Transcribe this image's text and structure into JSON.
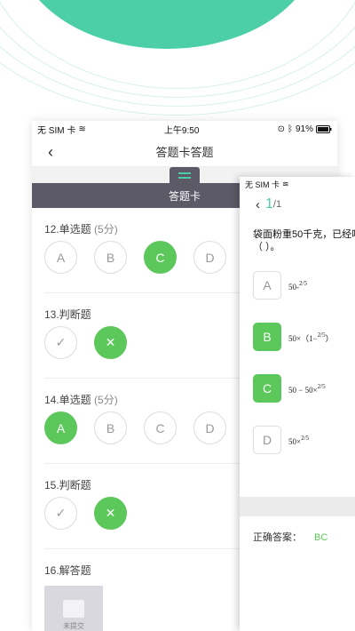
{
  "main": {
    "status": {
      "carrier": "无 SIM 卡",
      "time": "上午9:50",
      "battery": "91%"
    },
    "nav": {
      "title": "答题卡答题"
    },
    "card_bar": {
      "label": "答题卡"
    },
    "questions": [
      {
        "title": "12.单选题",
        "score": "(5分)",
        "options": [
          "A",
          "B",
          "C",
          "D"
        ],
        "selected": [
          "C"
        ]
      },
      {
        "title": "13.判断题",
        "options": [
          "✓",
          "✕"
        ],
        "selected": [
          "✕"
        ]
      },
      {
        "title": "14.单选题",
        "score": "(5分)",
        "options": [
          "A",
          "B",
          "C",
          "D"
        ],
        "selected": [
          "A"
        ]
      },
      {
        "title": "15.判断题",
        "options": [
          "✓",
          "✕"
        ],
        "selected": [
          "✕"
        ]
      },
      {
        "title": "16.解答题",
        "thumb_caption": "未提交"
      }
    ]
  },
  "detail": {
    "status": {
      "carrier": "无 SIM 卡"
    },
    "nav": {
      "current": "1",
      "total": "/1"
    },
    "question_line1": "袋面粉重50千克，已经吃",
    "question_line2": "（ ）。",
    "options": [
      {
        "label": "A",
        "formula": "50-",
        "fraction": "2/5",
        "selected": false
      },
      {
        "label": "B",
        "formula": "50×（1−",
        "fraction": "2/5",
        "suffix": "）",
        "selected": true
      },
      {
        "label": "C",
        "formula": "50 − 50×",
        "fraction": "2/5",
        "selected": true
      },
      {
        "label": "D",
        "formula": "50×",
        "fraction": "2/5",
        "selected": false
      }
    ],
    "answer_label": "正确答案：",
    "answer_value": "BC"
  },
  "colors": {
    "accent": "#4ccfa7",
    "selected": "#5cc75a",
    "bar": "#5b5a66"
  }
}
